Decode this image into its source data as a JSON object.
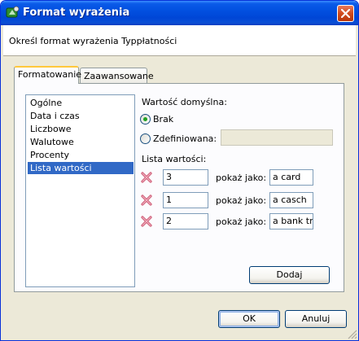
{
  "window": {
    "title": "Format wyrażenia"
  },
  "header": {
    "text": "Określ format wyrażenia Typpłatności"
  },
  "tabs": [
    {
      "label": "Formatowanie",
      "active": true
    },
    {
      "label": "Zaawansowane",
      "active": false
    }
  ],
  "categories": [
    {
      "label": "Ogólne"
    },
    {
      "label": "Data i czas"
    },
    {
      "label": "Liczbowe"
    },
    {
      "label": "Walutowe"
    },
    {
      "label": "Procenty"
    },
    {
      "label": "Lista wartości",
      "selected": true
    }
  ],
  "default_value": {
    "label": "Wartość domyślna:",
    "option_none": "Brak",
    "option_defined": "Zdefiniowana:",
    "selected": "Brak",
    "defined_value": ""
  },
  "value_list": {
    "label": "Lista wartości:",
    "show_as_label": "pokaż jako:",
    "rows": [
      {
        "value": "3",
        "display": "a card"
      },
      {
        "value": "1",
        "display": "a casch"
      },
      {
        "value": "2",
        "display": "a bank tra"
      }
    ]
  },
  "buttons": {
    "add": "Dodaj",
    "ok": "OK",
    "cancel": "Anuluj"
  },
  "colors": {
    "titlebar": "#0250e0",
    "selection": "#3169c6",
    "radio_dot": "#21a121",
    "delete_icon": "#d0607a"
  }
}
